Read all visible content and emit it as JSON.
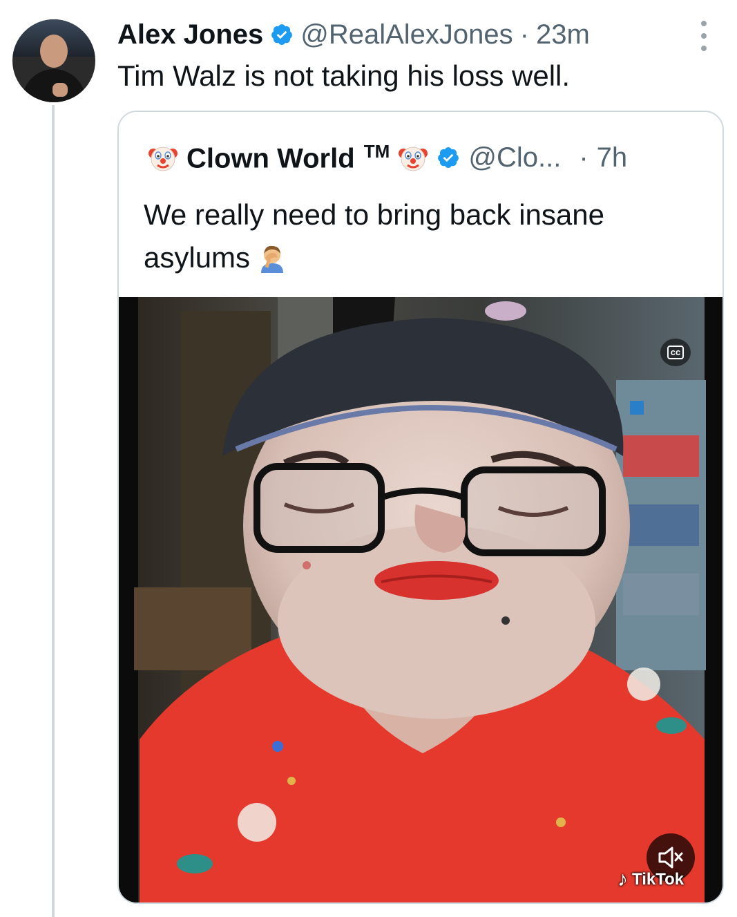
{
  "tweet": {
    "author_name": "Alex Jones",
    "author_handle": "@RealAlexJones",
    "separator": "·",
    "time": "23m",
    "text": "Tim Walz is not taking his loss well."
  },
  "quoted_tweet": {
    "author_name": "Clown World",
    "trademark": "TM",
    "author_handle": "@Clo...",
    "separator": "·",
    "time": "7h",
    "text": "We really need to bring back insane asylums"
  },
  "video": {
    "captions_label": "cc",
    "watermark": "TikTok"
  },
  "icons": {
    "verified": "verified-badge-icon",
    "more": "more-vertical-icon",
    "clown": "clown-face-emoji",
    "facepalm": "facepalm-emoji",
    "mute": "speaker-muted-icon",
    "tiktok": "tiktok-logo-icon"
  },
  "colors": {
    "verified_blue": "#1d9bf0",
    "text_primary": "#0f1419",
    "text_secondary": "#536471",
    "border": "#cfd9de",
    "shirt_red": "#e5392d"
  }
}
